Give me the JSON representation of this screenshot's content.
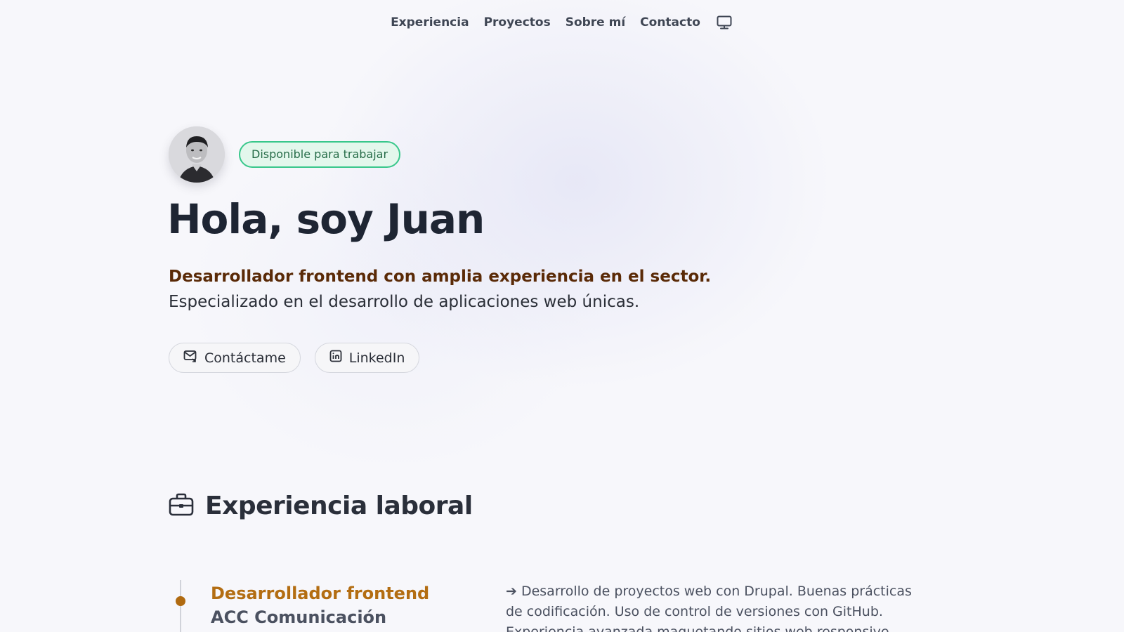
{
  "nav": {
    "items": [
      "Experiencia",
      "Proyectos",
      "Sobre mí",
      "Contacto"
    ],
    "theme_icon": "monitor-icon"
  },
  "hero": {
    "avatar_icon": "profile-photo",
    "badge": "Disponible para trabajar",
    "title": "Hola, soy Juan",
    "lead_strong": "Desarrollador frontend con amplia experiencia en el sector.",
    "lead_sub": "Especializado en el desarrollo de aplicaciones web únicas.",
    "buttons": [
      {
        "label": "Contáctame",
        "icon": "mail-icon"
      },
      {
        "label": "LinkedIn",
        "icon": "linkedin-icon"
      }
    ]
  },
  "experience": {
    "icon": "briefcase-icon",
    "title": "Experiencia laboral",
    "jobs": [
      {
        "role": "Desarrollador frontend",
        "company": "ACC Comunicación",
        "description": "➔ Desarrollo de proyectos web con Drupal. Buenas prácticas de codificación. Uso de control de versiones con GitHub. Experiencia avanzada maquetando sitios web responsive."
      }
    ]
  },
  "colors": {
    "accent": "#b36d12",
    "badge_border": "#38c78b",
    "badge_bg": "#e3f7ec",
    "heading": "#1e2533"
  }
}
